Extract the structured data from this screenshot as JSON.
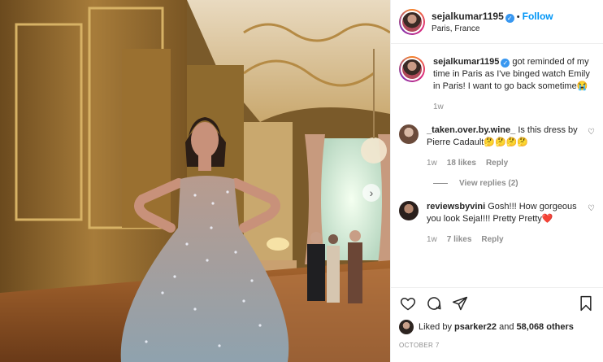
{
  "post": {
    "username": "sejalkumar1195",
    "follow_label": "Follow",
    "location": "Paris, France",
    "caption": "got reminded of my time in Paris as I've binged watch Emily in Paris! I want to go back sometime😭",
    "caption_time": "1w"
  },
  "comments": [
    {
      "username": "_taken.over.by.wine_",
      "text": "Is this dress by Pierre Cadault🤔🤔🤔🤔",
      "time": "1w",
      "likes": "18 likes",
      "reply": "Reply",
      "view_replies": "View replies (2)"
    },
    {
      "username": "reviewsbyvini",
      "text": "Gosh!!! How gorgeous you look Seja!!!! Pretty Pretty❤️",
      "time": "1w",
      "likes": "7 likes",
      "reply": "Reply"
    }
  ],
  "likes_bar": {
    "liked_by_prefix": "Liked by",
    "liked_by_user": "psarker22",
    "and_label": "and",
    "others": "58,068 others"
  },
  "date": "OCTOBER 7",
  "colors": {
    "accent": "#0095f6",
    "verified": "#3897f0",
    "muted": "#8e8e8e"
  },
  "icons": [
    "verified-icon",
    "heart-icon",
    "comment-icon",
    "share-icon",
    "bookmark-icon",
    "next-arrow-icon"
  ]
}
